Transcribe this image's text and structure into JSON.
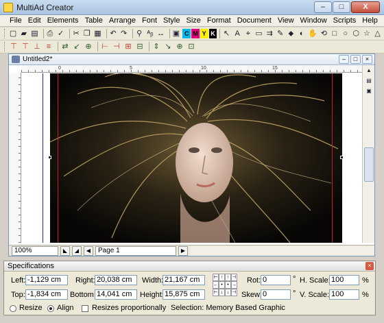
{
  "window": {
    "title": "MultiAd Creator",
    "minimize_label": "–",
    "maximize_label": "□",
    "close_label": "X"
  },
  "menu": [
    "File",
    "Edit",
    "Elements",
    "Table",
    "Arrange",
    "Font",
    "Style",
    "Size",
    "Format",
    "Document",
    "View",
    "Window",
    "Scripts",
    "Help"
  ],
  "toolbar1": {
    "icons": [
      "new-icon",
      "open-icon",
      "save-icon",
      "print-icon",
      "spell-icon",
      "cut-icon",
      "copy-icon",
      "paste-icon",
      "undo-icon",
      "redo-icon",
      "binoculars-icon",
      "replace-icon",
      "spacing-icon",
      "color-picker-icon"
    ],
    "glyphs": [
      "▢",
      "▰",
      "▤",
      "⎙",
      "✓",
      "✂",
      "❐",
      "▦",
      "↶",
      "↷",
      "⚲",
      "ᴬᵦ",
      "↔",
      "▣"
    ],
    "colors": [
      {
        "label": "C",
        "bg": "#00b7eb"
      },
      {
        "label": "M",
        "bg": "#e4007c"
      },
      {
        "label": "Y",
        "bg": "#ffef00"
      },
      {
        "label": "K",
        "bg": "#000000"
      }
    ],
    "tools": [
      "↖",
      "A",
      "⌖",
      "▭",
      "⇉",
      "✎",
      "⬥",
      "◐",
      "✋",
      "⟲",
      "□",
      "○",
      "⬡",
      "☆",
      "△"
    ],
    "tool_icons": [
      "pointer-tool-icon",
      "text-tool-icon",
      "rotate-tool-icon",
      "frame-tool-icon",
      "link-tool-icon",
      "pen-tool-icon",
      "bezier-tool-icon",
      "shade-tool-icon",
      "hand-tool-icon",
      "zoom-tool-icon",
      "rectangle-tool-icon",
      "ellipse-tool-icon",
      "polygon-tool-icon",
      "star-tool-icon",
      "triangle-tool-icon"
    ]
  },
  "toolbar2": {
    "glyphs": [
      "⊤",
      "⊤",
      "⊥",
      "≡",
      "⇄",
      "↙",
      "⊕",
      "⊢",
      "⊣",
      "⊞",
      "⊟",
      "⇕",
      "↘",
      "⊕",
      "⊡"
    ],
    "icons": [
      "align-top-icon",
      "align-center-icon",
      "align-bottom-icon",
      "distribute-icon",
      "swap-icon",
      "move-icon",
      "group-icon",
      "align-left-icon",
      "align-right-icon",
      "grid-icon",
      "ungroup-icon",
      "flip-icon",
      "move-down-icon",
      "lock-icon",
      "unlock-icon"
    ]
  },
  "document": {
    "title": "Untitled2*",
    "ruler_ticks": [
      "0",
      "5",
      "10",
      "15"
    ],
    "zoom": "100%",
    "page": "Page 1"
  },
  "spec": {
    "title": "Specifications",
    "left_label": "Left:",
    "left_value": "-1,129 cm",
    "top_label": "Top:",
    "top_value": "-1,834 cm",
    "right_label": "Right:",
    "right_value": "20,038 cm",
    "bottom_label": "Bottom:",
    "bottom_value": "14,041 cm",
    "width_label": "Width:",
    "width_value": "21,167 cm",
    "height_label": "Height:",
    "height_value": "15,875 cm",
    "rot_label": "Rot:",
    "rot_value": "0",
    "skew_label": "Skew:",
    "skew_value": "0",
    "degree": "°",
    "hscale_label": "H. Scale:",
    "hscale_value": "100",
    "vscale_label": "V. Scale:",
    "vscale_value": "100",
    "percent": "%",
    "resize_label": "Resize",
    "align_label": "Align",
    "resizes_prop_label": "Resizes proportionally",
    "selection_label": "Selection: Memory Based Graphic"
  }
}
